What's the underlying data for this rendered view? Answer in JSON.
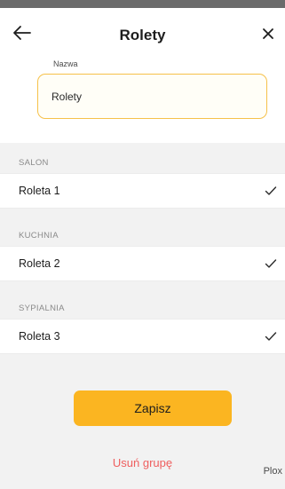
{
  "header": {
    "title": "Rolety",
    "back_icon": "arrow-left-icon",
    "close_icon": "close-icon"
  },
  "name_field": {
    "label": "Nazwa",
    "value": "Rolety"
  },
  "rooms": [
    {
      "section": "SALON",
      "device": "Roleta 1",
      "checked": true
    },
    {
      "section": "KUCHNIA",
      "device": "Roleta 2",
      "checked": true
    },
    {
      "section": "SYPIALNIA",
      "device": "Roleta 3",
      "checked": true
    }
  ],
  "actions": {
    "save_label": "Zapisz",
    "delete_label": "Usuń grupę"
  },
  "watermark": "Plox",
  "colors": {
    "accent": "#fbb521",
    "input_border": "#f6c14a",
    "danger": "#ef5f5f",
    "background": "#f2f2f2"
  }
}
